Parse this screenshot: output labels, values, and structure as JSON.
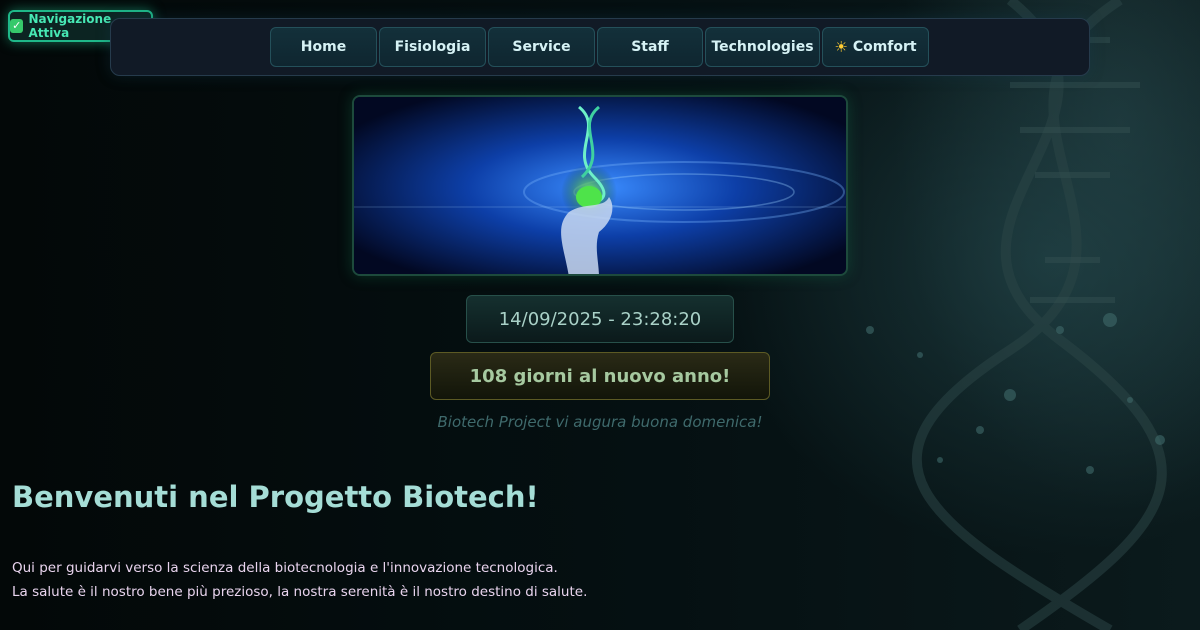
{
  "status_badge": {
    "icon": "check-icon",
    "label": "Navigazione Attiva"
  },
  "nav": {
    "items": [
      {
        "label": "Home"
      },
      {
        "label": "Fisiologia"
      },
      {
        "label": "Service"
      },
      {
        "label": "Staff"
      },
      {
        "label": "Technologies"
      },
      {
        "label": "Comfort",
        "icon": "sun-icon"
      }
    ]
  },
  "hero": {
    "alt": "hand holding glowing DNA helix"
  },
  "clock": {
    "datetime": "14/09/2025 - 23:28:20"
  },
  "countdown": {
    "text": "108 giorni al nuovo anno!"
  },
  "greeting": {
    "text": "Biotech Project vi augura buona domenica!"
  },
  "welcome": {
    "title": "Benvenuti nel Progetto Biotech!",
    "line1": "Qui per guidarvi verso la scienza della biotecnologia e l'innovazione tecnologica.",
    "line2": "La salute è il nostro bene più prezioso, la nostra serenità è il nostro destino di salute."
  },
  "colors": {
    "accent_green": "#1fb889",
    "background": "#040a0b",
    "title_color": "#a5ddd6",
    "intro_color": "#e9d4ee"
  }
}
